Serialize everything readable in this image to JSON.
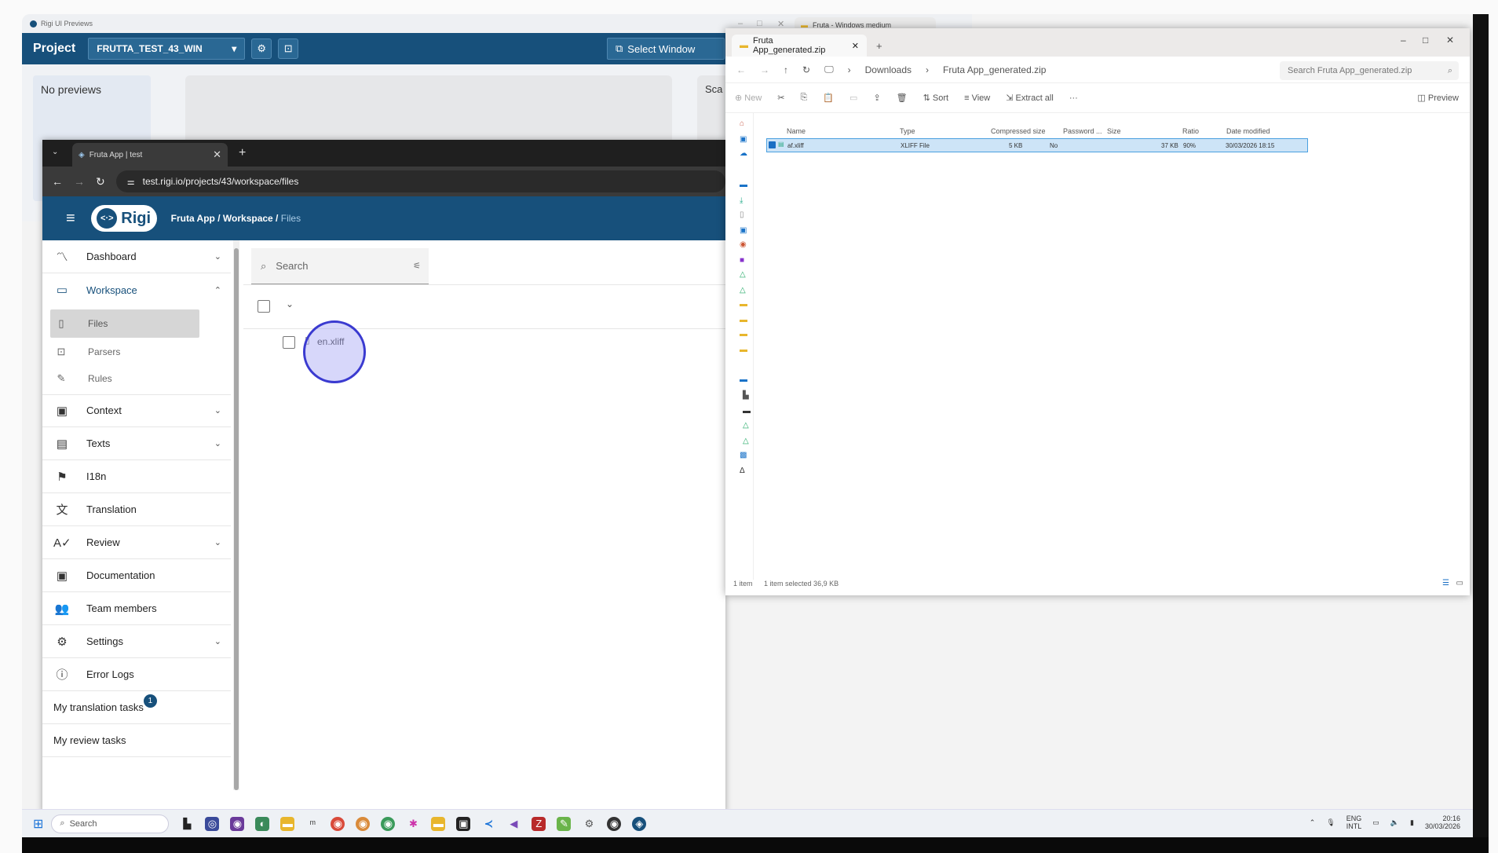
{
  "previews_window": {
    "title": "Rigi UI Previews",
    "project_label": "Project",
    "project_value": "FRUTTA_TEST_43_WIN",
    "select_window_label": "Select Window",
    "no_previews": "No previews",
    "scan_partial": "Sca"
  },
  "browser": {
    "tab_title": "Fruta App | test",
    "url": "test.rigi.io/projects/43/workspace/files",
    "logo_text": "Rigi",
    "breadcrumb": {
      "project": "Fruta App",
      "sep1": " / ",
      "section": "Workspace",
      "sep2": " / ",
      "page": "Files"
    },
    "sidebar": {
      "dashboard": "Dashboard",
      "workspace": "Workspace",
      "files": "Files",
      "parsers": "Parsers",
      "rules": "Rules",
      "context": "Context",
      "texts": "Texts",
      "i18n": "I18n",
      "translation": "Translation",
      "review": "Review",
      "documentation": "Documentation",
      "team_members": "Team members",
      "settings": "Settings",
      "error_logs": "Error Logs",
      "my_translation_tasks": "My translation tasks",
      "translation_tasks_badge": "1",
      "my_review_tasks": "My review tasks"
    },
    "main": {
      "search_placeholder": "Search",
      "file_name": "en.xliff"
    }
  },
  "explorer": {
    "tab_title": "Fruta App_generated.zip",
    "path": [
      "Downloads",
      "Fruta App_generated.zip"
    ],
    "search_placeholder": "Search Fruta App_generated.zip",
    "commands": {
      "new": "New",
      "sort": "Sort",
      "view": "View",
      "extract_all": "Extract all",
      "more": "···",
      "preview": "Preview"
    },
    "columns": {
      "name": "Name",
      "type": "Type",
      "compressed_size": "Compressed size",
      "password": "Password ...",
      "size": "Size",
      "ratio": "Ratio",
      "date_modified": "Date modified"
    },
    "row": {
      "name": "af.xliff",
      "type": "XLIFF File",
      "compressed_size": "5 KB",
      "password": "No",
      "size": "37 KB",
      "ratio": "90%",
      "date_modified": "30/03/2026 18:15"
    },
    "status": {
      "items": "1 item",
      "selected": "1 item selected  36,9 KB"
    }
  },
  "other_tab": "Fruta - Windows medium",
  "taskbar": {
    "search_placeholder": "Search",
    "lang_top": "ENG",
    "lang_bottom": "INTL",
    "time": "20:16",
    "date": "30/03/2026"
  },
  "colors": {
    "brand": "#17507b",
    "selection": "#cde4f7",
    "cursor": "#3a3ad0"
  }
}
